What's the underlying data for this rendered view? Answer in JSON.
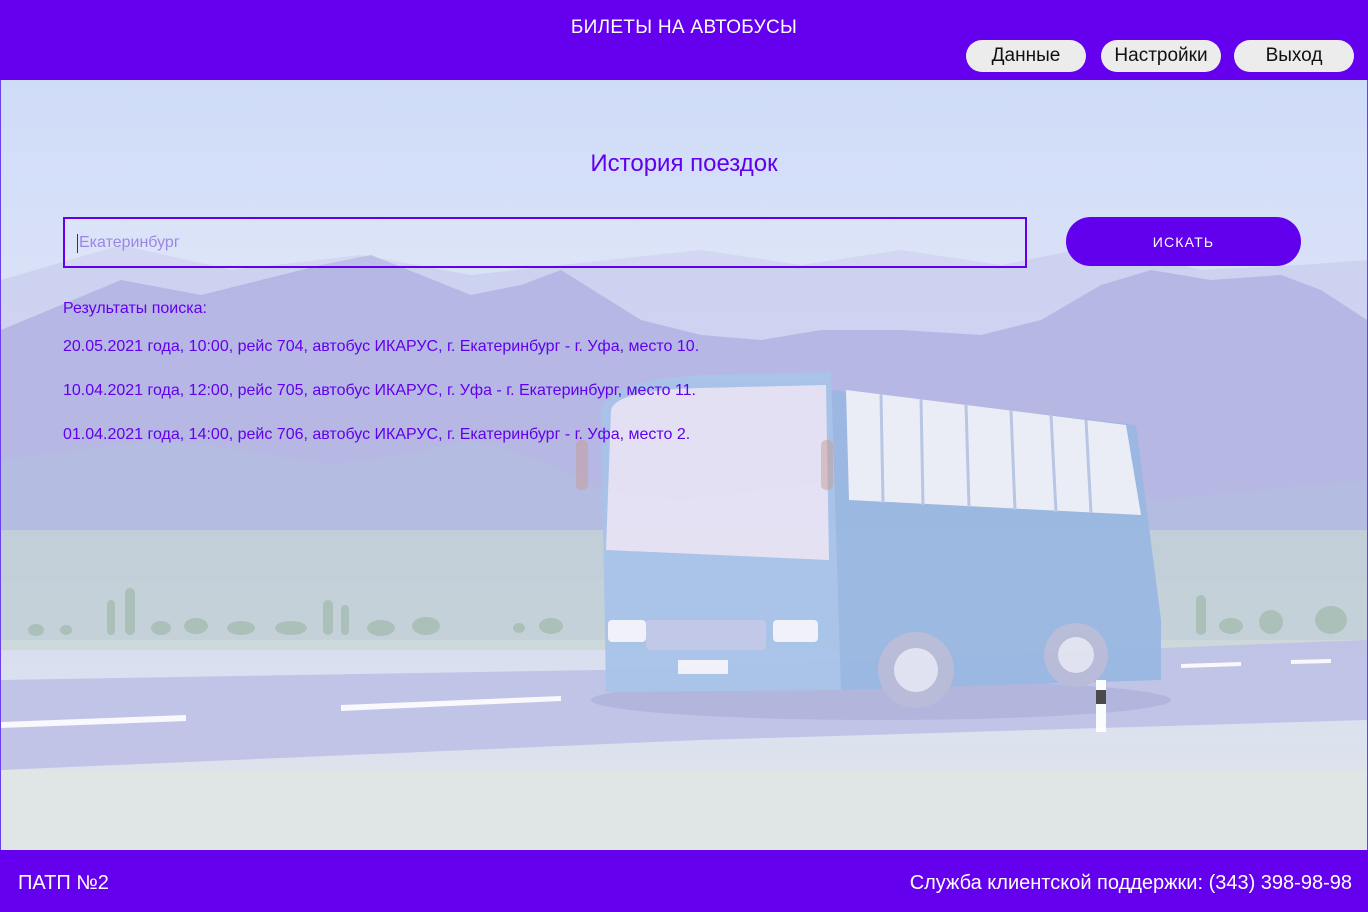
{
  "header": {
    "title": "БИЛЕТЫ НА АВТОБУСЫ",
    "buttons": {
      "data": "Данные",
      "settings": "Настройки",
      "exit": "Выход"
    }
  },
  "main": {
    "title": "История поездок",
    "search": {
      "placeholder": "Екатеринбург",
      "button_label": "ИСКАТЬ"
    },
    "results_label": "Результаты поиска:",
    "results": [
      "20.05.2021 года, 10:00, рейс 704, автобус ИКАРУС, г. Екатеринбург - г. Уфа, место 10.",
      "10.04.2021 года, 12:00, рейс 705, автобус ИКАРУС, г. Уфа - г. Екатеринбург, место 11.",
      "01.04.2021 года, 14:00, рейс 706, автобус ИКАРУС, г. Екатеринбург - г. Уфа, место 2."
    ]
  },
  "footer": {
    "org": "ПАТП №2",
    "support": "Служба клиентской поддержки: (343) 398-98-98"
  },
  "colors": {
    "brand": "#6500ee",
    "accent": "#6200ee",
    "button_bg": "#ececec"
  },
  "icons": {
    "background": "bus-illustration"
  }
}
